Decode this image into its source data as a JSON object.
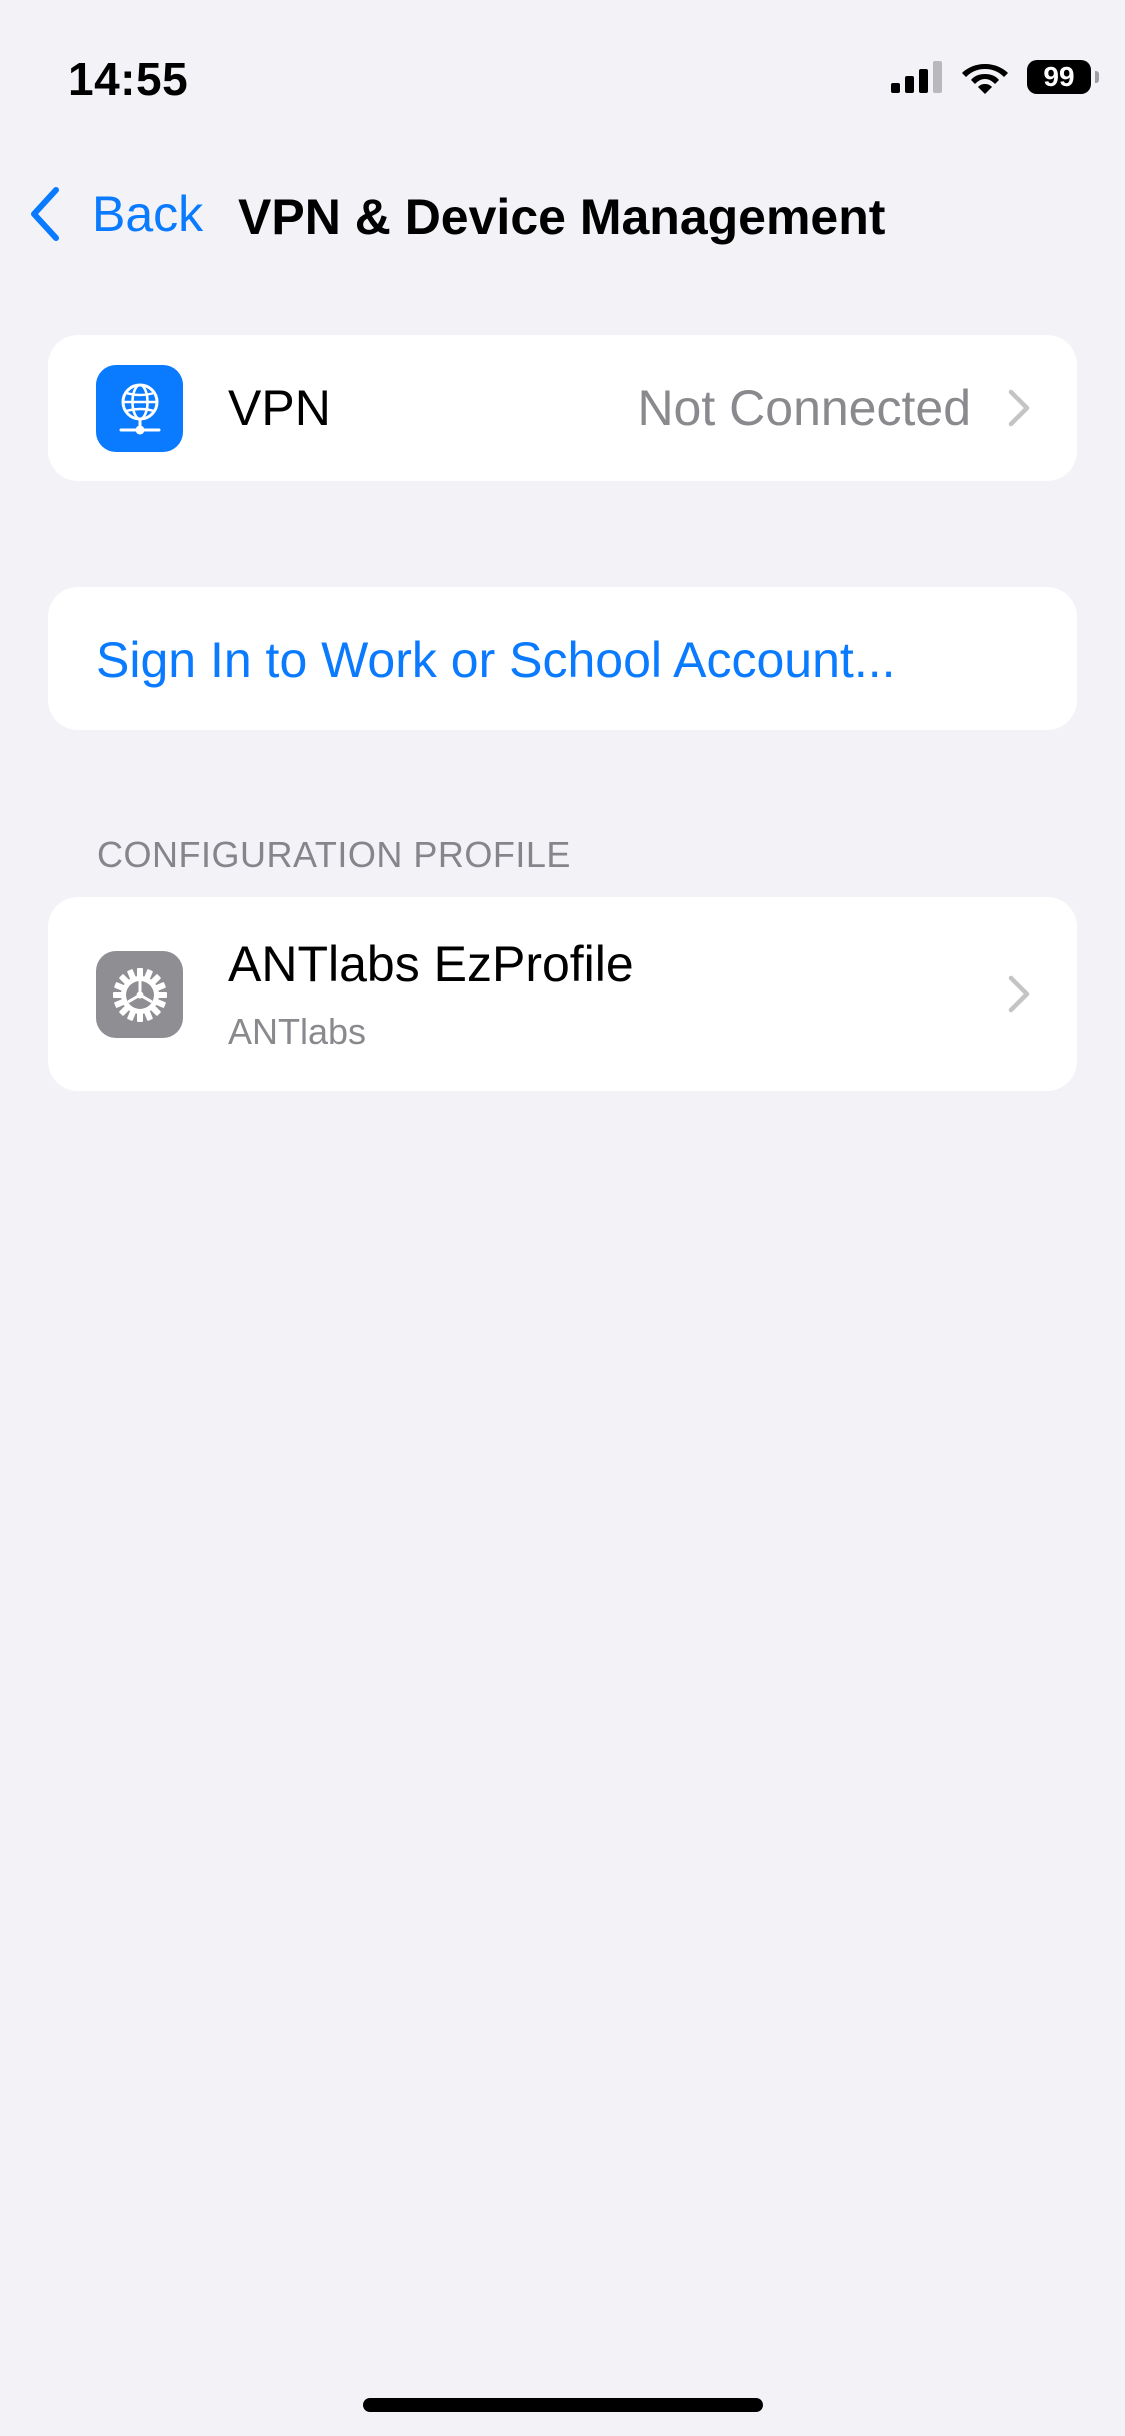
{
  "status_bar": {
    "time": "14:55",
    "battery_level": "99",
    "signal_icon": "cellular-signal-icon",
    "wifi_icon": "wifi-icon"
  },
  "nav": {
    "back_label": "Back",
    "title": "VPN & Device Management",
    "back_icon": "chevron-left-icon"
  },
  "vpn_row": {
    "icon": "vpn-globe-icon",
    "title": "VPN",
    "status": "Not Connected",
    "chevron_icon": "chevron-right-icon"
  },
  "account": {
    "sign_in_label": "Sign In to Work or School Account..."
  },
  "configuration_profile": {
    "section_header": "CONFIGURATION PROFILE",
    "items": [
      {
        "icon": "gear-icon",
        "title": "ANTlabs EzProfile",
        "subtitle": "ANTlabs",
        "chevron_icon": "chevron-right-icon"
      }
    ]
  },
  "colors": {
    "accent": "#0a7aff",
    "background": "#f2f2f7",
    "secondary_text": "#8a8a8e",
    "gear_icon_bg": "#8e8e93"
  }
}
